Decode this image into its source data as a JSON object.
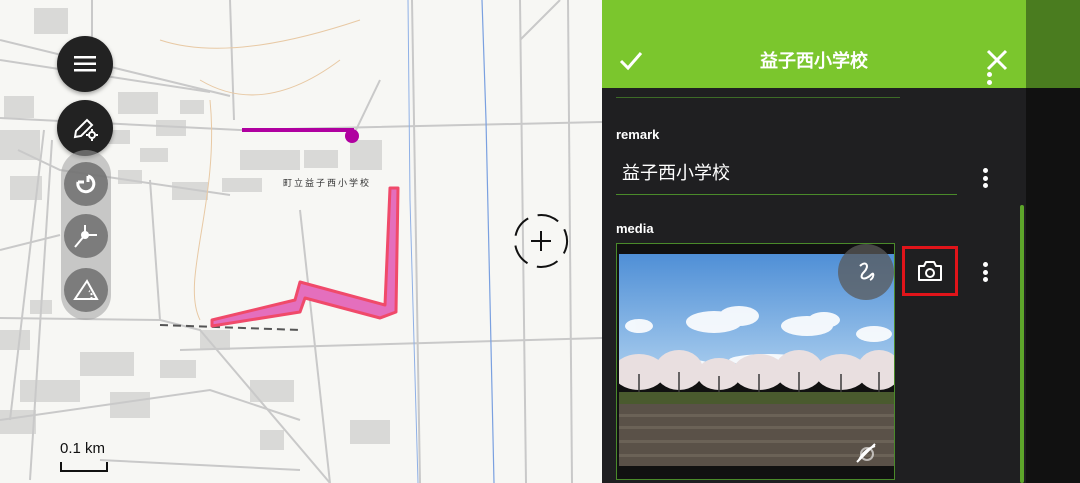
{
  "map": {
    "school_label": "町立益子西小学校",
    "scale_label": "0.1 km",
    "menu_icon": "menu-icon",
    "edit_icon": "edit-settings-icon",
    "tools": [
      "magnet-snap-icon",
      "vertex-icon",
      "angle-icon"
    ],
    "crosshair_icon": "crosshair-icon"
  },
  "panel": {
    "title": "益子西小学校",
    "confirm_icon": "check-icon",
    "close_icon": "close-icon",
    "fields": {
      "remark": {
        "label": "remark",
        "value": "益子西小学校"
      },
      "media": {
        "label": "media",
        "photo_subject": "cherry blossom trees under blue sky",
        "draw_icon": "draw-icon",
        "camera_icon": "camera-icon",
        "hidden_icon": "visibility-off-icon"
      }
    }
  },
  "colors": {
    "header_green": "#7bc62d",
    "panel_bg": "#1f1f21",
    "highlight_red": "#e0141a",
    "polygon_pink": "#e46fbd",
    "line_magenta": "#b000a0"
  }
}
